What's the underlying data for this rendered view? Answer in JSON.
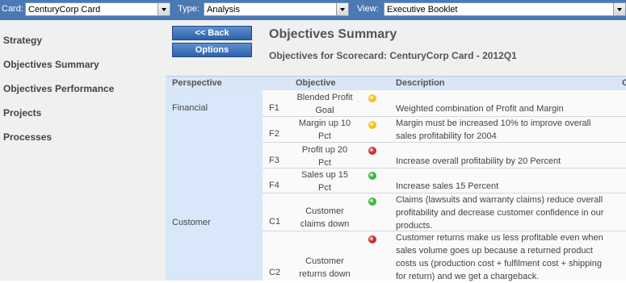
{
  "toolbar": {
    "card_label": "Card:",
    "card_value": "CenturyCorp Card",
    "type_label": "Type:",
    "type_value": "Analysis",
    "view_label": "View:",
    "view_value": "Executive Booklet"
  },
  "nav": {
    "items": [
      {
        "label": "Strategy"
      },
      {
        "label": "Objectives Summary"
      },
      {
        "label": "Objectives Performance"
      },
      {
        "label": "Projects"
      },
      {
        "label": "Processes"
      }
    ]
  },
  "main": {
    "back_label": "<< Back",
    "options_label": "Options",
    "title": "Objectives Summary",
    "subtitle": "Objectives for Scorecard: CenturyCorp Card - 2012Q1"
  },
  "table": {
    "headers": {
      "perspective": "Perspective",
      "objective": "Objective",
      "description": "Description",
      "extra": "C"
    },
    "perspectives": [
      {
        "label": "Financial"
      },
      {
        "label": "Customer"
      }
    ],
    "rows": [
      {
        "code": "F1",
        "objective": "Blended Profit Goal",
        "status": "yellow",
        "description": "Weighted combination of Profit and Margin"
      },
      {
        "code": "F2",
        "objective": "Margin up 10 Pct",
        "status": "yellow",
        "description": "Margin must be increased 10% to improve overall sales profitability for 2004"
      },
      {
        "code": "F3",
        "objective": "Profit up 20 Pct",
        "status": "red",
        "description": "Increase overall profitability by 20 Percent"
      },
      {
        "code": "F4",
        "objective": "Sales up 15 Pct",
        "status": "green",
        "description": "Increase sales 15 Percent"
      },
      {
        "code": "C1",
        "objective": "Customer claims down",
        "status": "green",
        "description": "Claims (lawsuits and warranty claims) reduce overall profitability and decrease customer confidence in our products."
      },
      {
        "code": "C2",
        "objective": "Customer returns down",
        "status": "red",
        "description": "Customer returns make us less profitable even when sales volume goes up because a returned product costs us (production cost + fulfilment cost + shipping for return) and we get a chargeback."
      }
    ],
    "status_colors": {
      "yellow": "#f2c418",
      "red": "#c83232",
      "green": "#3cb83c"
    }
  }
}
